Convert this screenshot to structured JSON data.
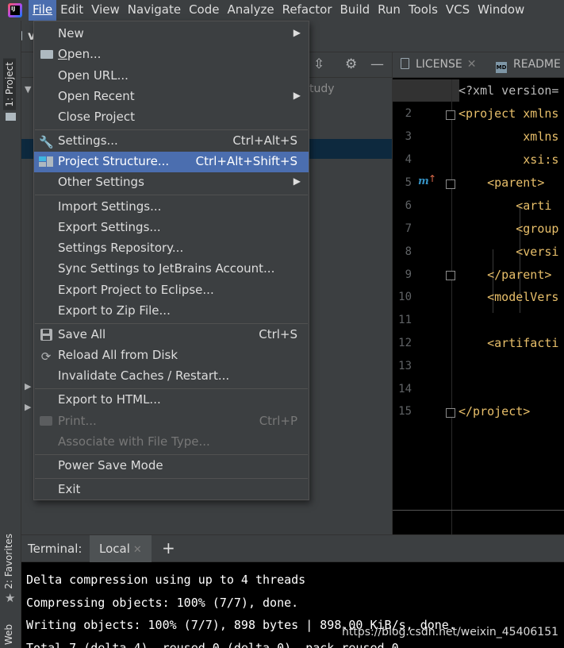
{
  "menubar": {
    "logo_text": "IJ",
    "items": [
      {
        "label": "File",
        "mnemonic_index": 0
      },
      {
        "label": "Edit",
        "mnemonic_index": 0
      },
      {
        "label": "View",
        "mnemonic_index": 0
      },
      {
        "label": "Navigate",
        "mnemonic_index": 0
      },
      {
        "label": "Code",
        "mnemonic_index": 0
      },
      {
        "label": "Analyze",
        "mnemonic_index": -1
      },
      {
        "label": "Refactor",
        "mnemonic_index": 0
      },
      {
        "label": "Build",
        "mnemonic_index": 0
      },
      {
        "label": "Run",
        "mnemonic_index": 0
      },
      {
        "label": "Tools",
        "mnemonic_index": 0
      },
      {
        "label": "VCS",
        "mnemonic_index": 2
      },
      {
        "label": "Window",
        "mnemonic_index": 0
      }
    ]
  },
  "navbar": {
    "project_label": "v"
  },
  "left_strip": {
    "project_tab": "1: Project",
    "favorites_tab": "2: Favorites",
    "web_tab": "Web"
  },
  "project_panel": {
    "tree_partial_text": "tudy"
  },
  "file_menu": {
    "items": [
      {
        "label": "New",
        "submenu": true
      },
      {
        "label": "Open...",
        "icon": "folder-icon",
        "u": "O",
        "rest": "pen..."
      },
      {
        "label": "Open URL..."
      },
      {
        "label": "Open Recent",
        "submenu": true,
        "u": "R"
      },
      {
        "label": "Close Project"
      },
      {
        "label": "Settings...",
        "shortcut": "Ctrl+Alt+S",
        "icon": "wrench-icon"
      },
      {
        "label": "Project Structure...",
        "shortcut": "Ctrl+Alt+Shift+S",
        "icon": "project-structure-icon"
      },
      {
        "label": "Other Settings",
        "submenu": true
      },
      {
        "label": "Import Settings..."
      },
      {
        "label": "Export Settings..."
      },
      {
        "label": "Settings Repository..."
      },
      {
        "label": "Sync Settings to JetBrains Account..."
      },
      {
        "label": "Export Project to Eclipse..."
      },
      {
        "label": "Export to Zip File..."
      },
      {
        "label": "Save All",
        "shortcut": "Ctrl+S",
        "icon": "save-icon"
      },
      {
        "label": "Reload All from Disk",
        "icon": "reload-icon"
      },
      {
        "label": "Invalidate Caches / Restart..."
      },
      {
        "label": "Export to HTML..."
      },
      {
        "label": "Print...",
        "shortcut": "Ctrl+P",
        "icon": "print-icon",
        "disabled": true
      },
      {
        "label": "Associate with File Type...",
        "disabled": true
      },
      {
        "label": "Power Save Mode"
      },
      {
        "label": "Exit"
      }
    ]
  },
  "editor": {
    "tabs": [
      {
        "label": "LICENSE",
        "icon": "text-file-icon"
      },
      {
        "label": "README",
        "icon": "markdown-icon",
        "icon_text": "MD"
      }
    ],
    "lines": [
      {
        "no": "",
        "text": "<?xml version="
      },
      {
        "no": "2",
        "text": "<project xmlns"
      },
      {
        "no": "3",
        "text": "         xmlns"
      },
      {
        "no": "4",
        "text": "         xsi:s"
      },
      {
        "no": "5",
        "text": "    <parent>"
      },
      {
        "no": "6",
        "text": "        <arti"
      },
      {
        "no": "7",
        "text": "        <group"
      },
      {
        "no": "8",
        "text": "        <versi"
      },
      {
        "no": "9",
        "text": "    </parent>"
      },
      {
        "no": "10",
        "text": "    <modelVers"
      },
      {
        "no": "11",
        "text": ""
      },
      {
        "no": "12",
        "text": "    <artifacti"
      },
      {
        "no": "13",
        "text": ""
      },
      {
        "no": "14",
        "text": ""
      },
      {
        "no": "15",
        "text": "</project>"
      }
    ],
    "gutter_marker": "m"
  },
  "terminal": {
    "title": "Terminal:",
    "tab": "Local",
    "lines": [
      "Delta compression using up to 4 threads",
      "Compressing objects: 100% (7/7), done.",
      "Writing objects: 100% (7/7), 898 bytes | 898.00 KiB/s, done.",
      "Total 7 (delta 4), reused 0 (delta 0), pack-reused 0"
    ]
  },
  "watermark": "https://blog.csdn.net/weixin_45406151",
  "colors": {
    "menu_bg": "#3c3f41",
    "selection": "#4b6eaf",
    "xml_tag": "#e8bf6a",
    "editor_bg": "#000000"
  }
}
